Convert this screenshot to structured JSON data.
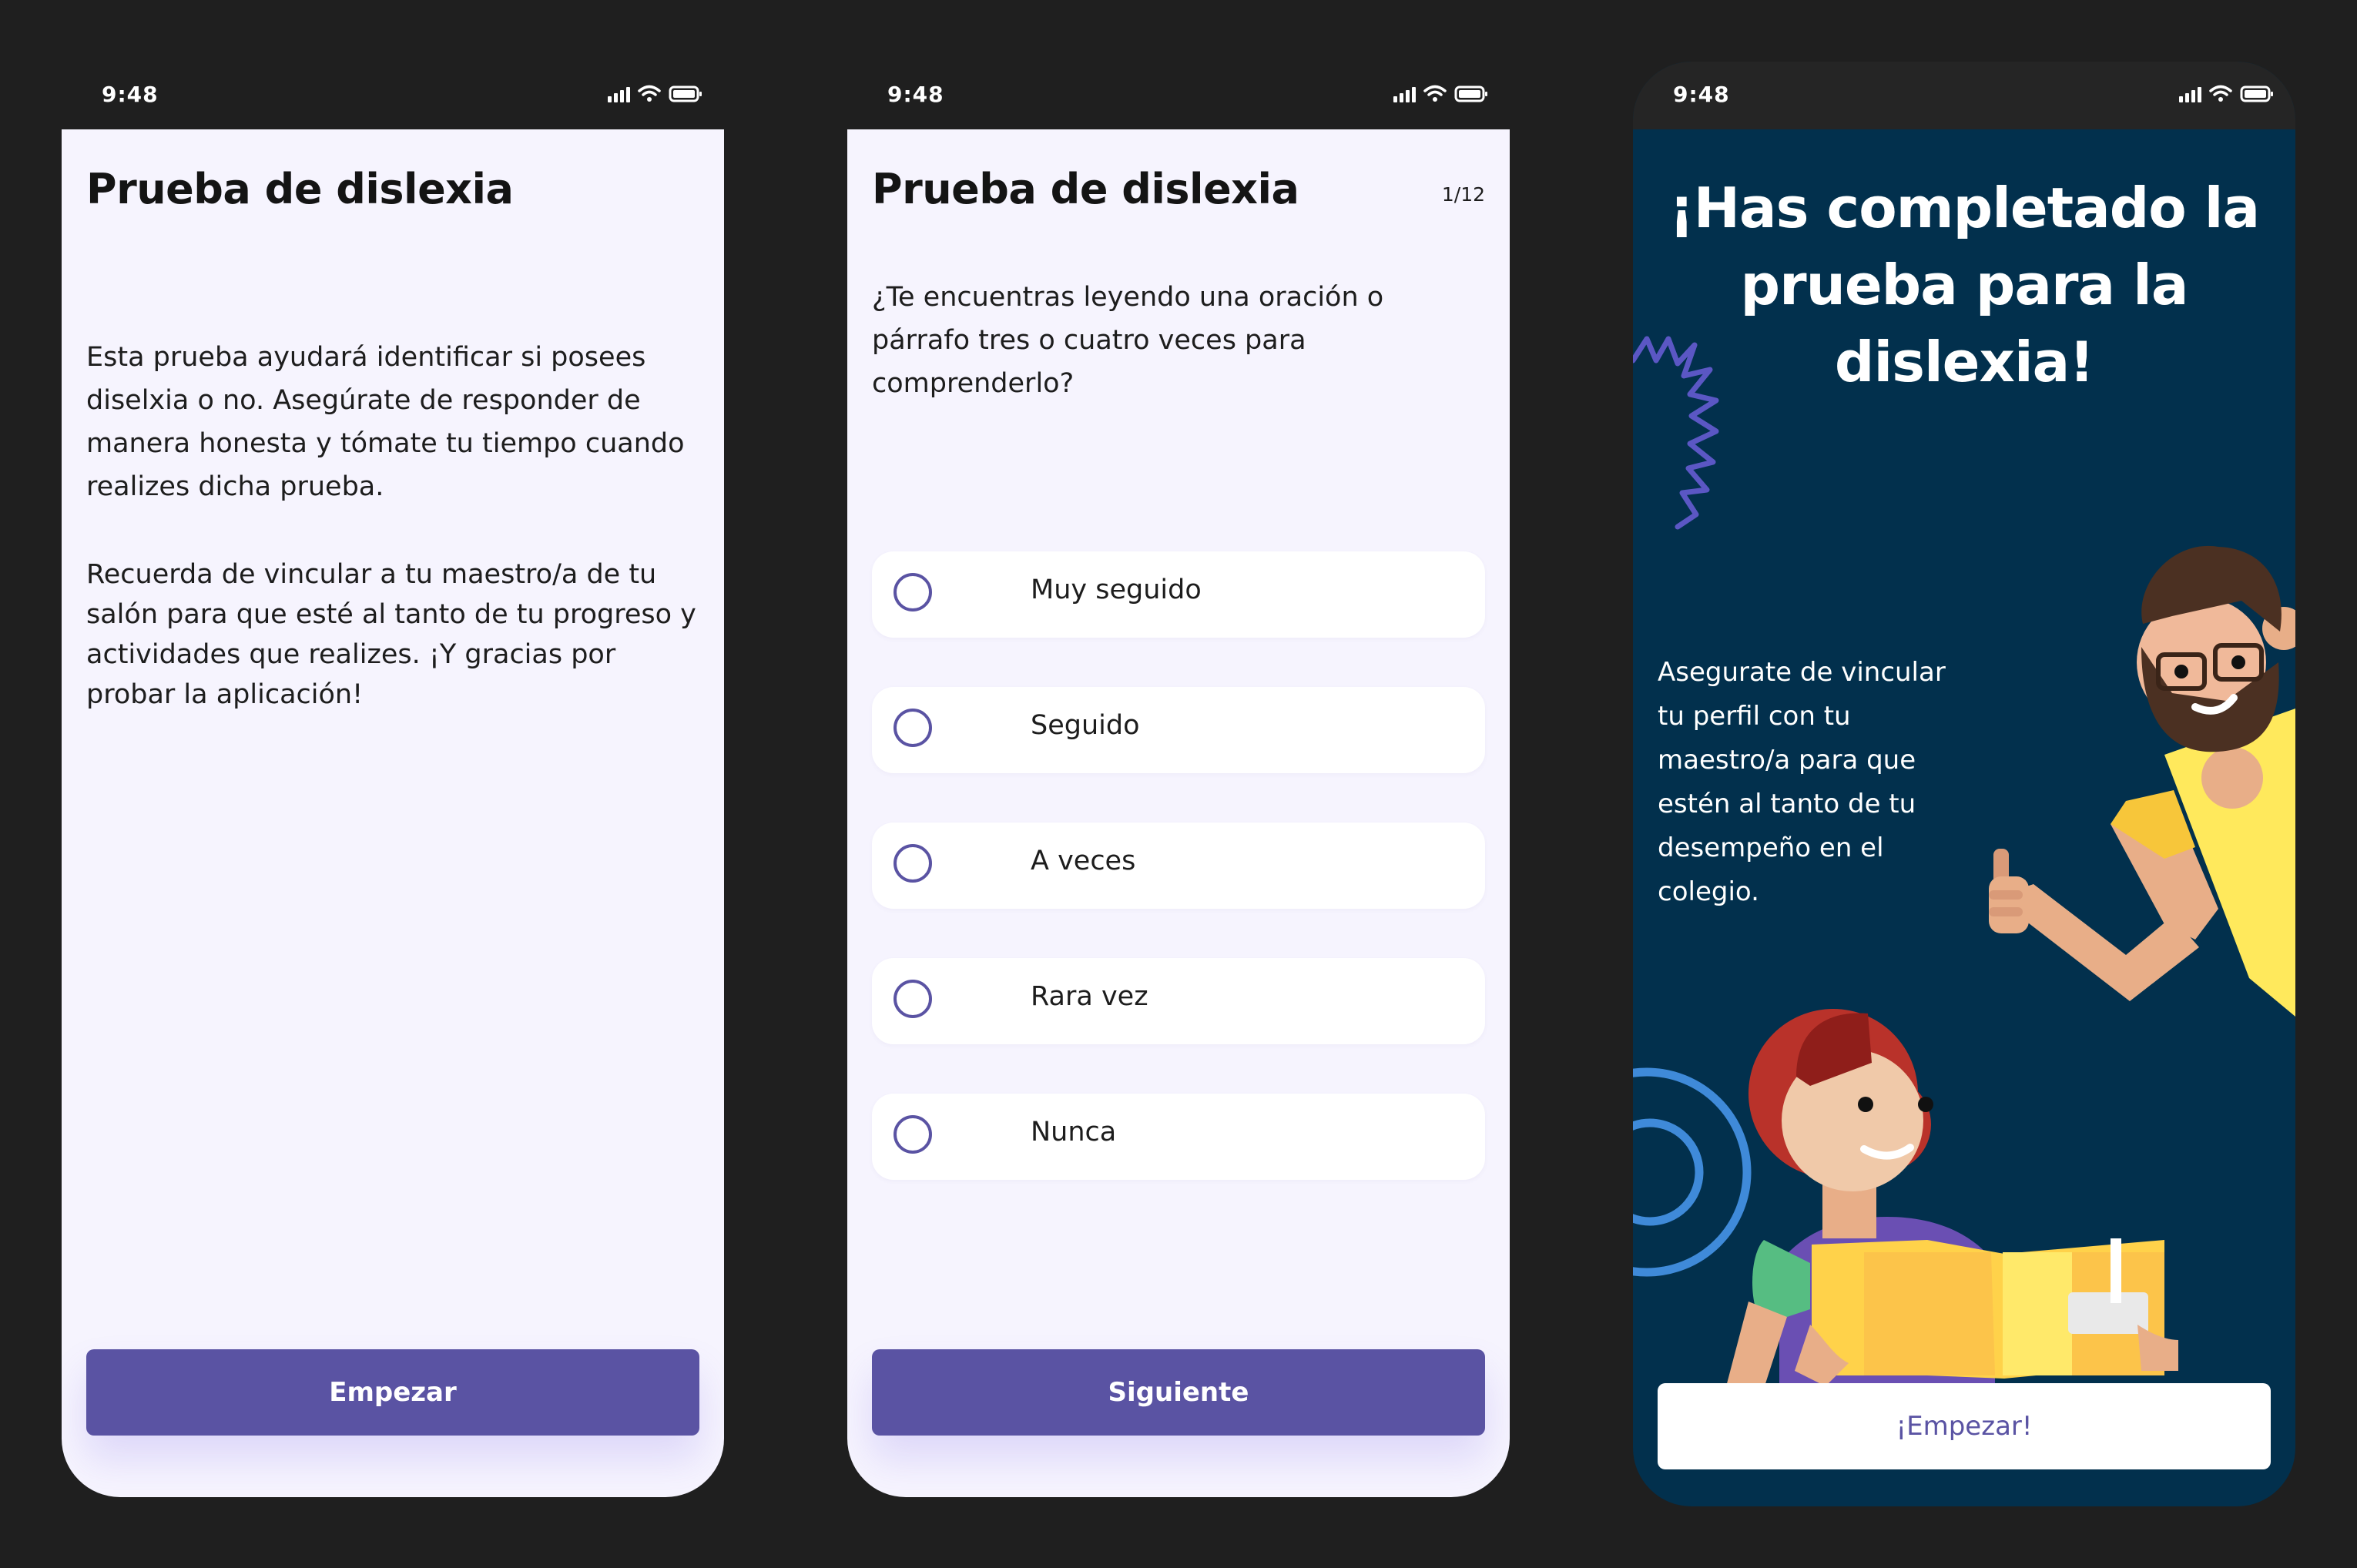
{
  "status_bar": {
    "time": "9:48"
  },
  "intro_screen": {
    "title": "Prueba de dislexia",
    "paragraph_1": "Esta prueba ayudará identificar si posees diselxia o no. Asegúrate de responder de manera honesta y tómate tu tiempo cuando realizes dicha prueba.",
    "paragraph_2": "Recuerda de vincular a tu maestro/a de tu salón para que esté al tanto de tu progreso y actividades que realizes. ¡Y gracias por probar la aplicación!",
    "start_button": "Empezar"
  },
  "question_screen": {
    "title": "Prueba de dislexia",
    "counter": "1/12",
    "question": "¿Te encuentras leyendo una oración o párrafo tres o cuatro veces para comprenderlo?",
    "options": [
      {
        "label": "Muy seguido"
      },
      {
        "label": "Seguido"
      },
      {
        "label": "A veces"
      },
      {
        "label": "Rara vez"
      },
      {
        "label": "Nunca"
      }
    ],
    "next_button": "Siguiente"
  },
  "completion_screen": {
    "title": "¡Has completado la prueba para la dislexia!",
    "message": "Asegurate de vincular tu perfil con tu maestro/a para que estén al tanto de tu desempeño en el colegio.",
    "start_button": "¡Empezar!"
  },
  "colors": {
    "accent": "#5a53a3",
    "screen_background": "#f6f4fe",
    "completion_background": "#02304d",
    "page_background": "#1f1f1f"
  },
  "icons": [
    "signal-icon",
    "wifi-icon",
    "battery-icon",
    "radio-icon"
  ]
}
